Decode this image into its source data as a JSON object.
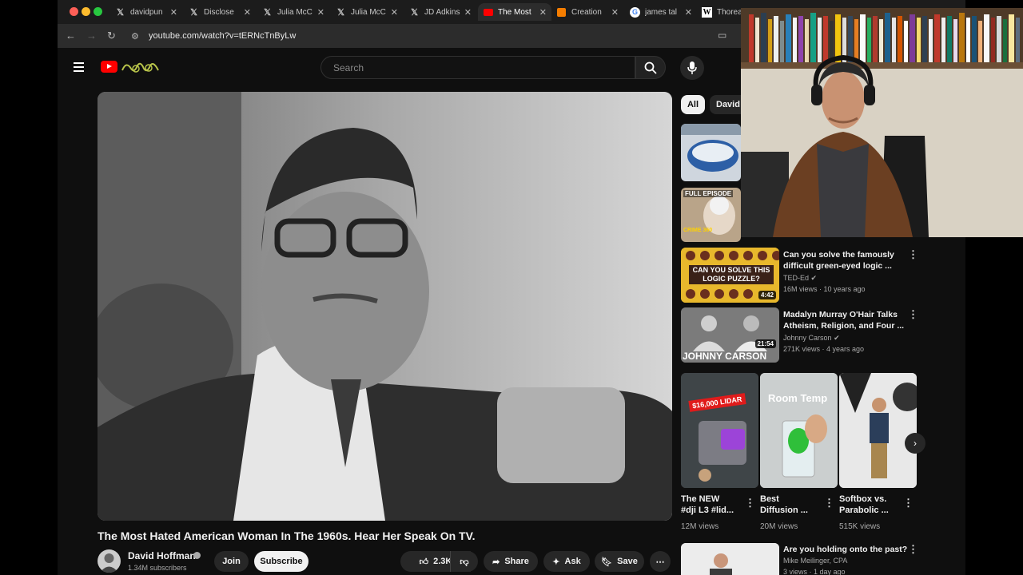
{
  "tabs": [
    {
      "icon": "x-logo-icon",
      "title": "davidpun"
    },
    {
      "icon": "x-logo-icon",
      "title": "Disclose"
    },
    {
      "icon": "x-logo-icon",
      "title": "Julia McC"
    },
    {
      "icon": "x-logo-icon",
      "title": "Julia McC"
    },
    {
      "icon": "x-logo-icon",
      "title": "JD Adkins"
    },
    {
      "icon": "youtube-icon",
      "title": "The Most",
      "active": true
    },
    {
      "icon": "blogger-icon",
      "title": "Creation"
    },
    {
      "icon": "google-icon",
      "title": "james tal"
    },
    {
      "icon": "wikipedia-icon",
      "title": "Thoreau"
    }
  ],
  "omnibox": {
    "url": "youtube.com/watch?v=tERNcTnByLw"
  },
  "header": {
    "search_placeholder": "Search"
  },
  "video": {
    "title": "The Most Hated American Woman In The 1960s. Hear Her Speak On TV.",
    "channel": "David Hoffman",
    "subscribers": "1.34M subscribers",
    "join_label": "Join",
    "subscribe_label": "Subscribe",
    "likes": "2.3K",
    "share_label": "Share",
    "ask_label": "Ask",
    "save_label": "Save"
  },
  "chips": [
    {
      "label": "All",
      "selected": true
    },
    {
      "label": "David H"
    }
  ],
  "recommendations": [
    {
      "title_line1": "Can you solve the famously",
      "title_line2": "difficult green-eyed logic ...",
      "channel": "TED-Ed",
      "meta": "16M views · 10 years ago",
      "duration": "4:42",
      "thumb_text": "CAN YOU SOLVE THIS LOGIC PUZZLE?"
    },
    {
      "title_line1": "Madalyn Murray O'Hair Talks",
      "title_line2": "Atheism, Religion, and Four ...",
      "channel": "Johnny Carson",
      "meta": "271K views · 4 years ago",
      "duration": "21:54",
      "thumb_text": "JOHNNY CARSON"
    }
  ],
  "thumb_labels": {
    "full_episode": "FULL EPISODE",
    "crime360": "CRIME 360"
  },
  "shorts": [
    {
      "title_line1": "The NEW",
      "title_line2": "#dji L3 #lid...",
      "views": "12M views",
      "badge": "$16,000 LIDAR"
    },
    {
      "title_line1": "Best",
      "title_line2": "Diffusion ...",
      "views": "20M views",
      "badge": "Room Temp"
    },
    {
      "title_line1": "Softbox vs.",
      "title_line2": "Parabolic ...",
      "views": "515K views",
      "badge": ""
    }
  ],
  "last_rec": {
    "title": "Are you holding onto the past?",
    "channel": "Mike Meilinger, CPA",
    "meta": "3 views · 1 day ago"
  },
  "colors": {
    "youtube_red": "#ff0000",
    "background": "#0f0f0f",
    "surface": "#272727"
  }
}
